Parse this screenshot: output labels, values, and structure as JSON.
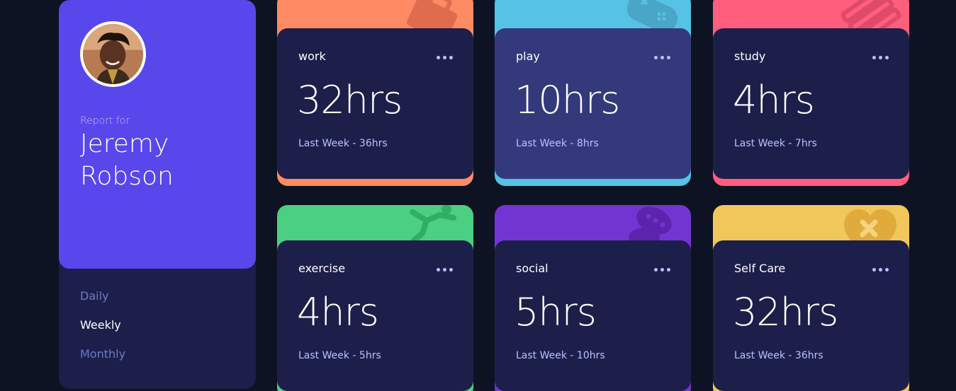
{
  "profile": {
    "report_for": "Report for",
    "name": "Jeremy Robson",
    "periods": [
      {
        "label": "Daily",
        "active": false
      },
      {
        "label": "Weekly",
        "active": true
      },
      {
        "label": "Monthly",
        "active": false
      }
    ]
  },
  "cards": [
    {
      "title": "work",
      "hours": "32hrs",
      "previous": "Last Week - 36hrs",
      "accent": "#ff8b64",
      "icon": "briefcase-icon"
    },
    {
      "title": "play",
      "hours": "10hrs",
      "previous": "Last Week - 8hrs",
      "accent": "#55c2e6",
      "icon": "gamepad-icon"
    },
    {
      "title": "study",
      "hours": "4hrs",
      "previous": "Last Week - 7hrs",
      "accent": "#ff5e7d",
      "icon": "books-icon"
    },
    {
      "title": "exercise",
      "hours": "4hrs",
      "previous": "Last Week - 5hrs",
      "accent": "#4bcf82",
      "icon": "running-icon"
    },
    {
      "title": "social",
      "hours": "5hrs",
      "previous": "Last Week - 10hrs",
      "accent": "#7335d2",
      "icon": "chat-icon"
    },
    {
      "title": "Self Care",
      "hours": "32hrs",
      "previous": "Last Week - 36hrs",
      "accent": "#f1c75b",
      "icon": "heart-icon"
    }
  ],
  "colors": {
    "background": "#0e1323",
    "card": "#1c1f4a",
    "card_hover": "#33397a",
    "profile": "#5847eb",
    "pale_blue": "#bbc0ff",
    "desaturated_blue": "#7078c9"
  }
}
